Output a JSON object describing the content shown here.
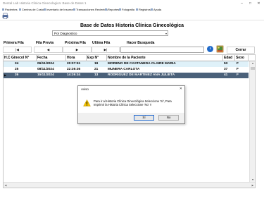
{
  "window": {
    "title": "Dental Lab Historia Clinica Ginecologica: Base de Datos 1",
    "controls": {
      "minimize": "–",
      "maximize": "□",
      "close": "✕"
    }
  },
  "menu": {
    "items": [
      {
        "label": "Pacientes"
      },
      {
        "label": "Centros de Costos"
      },
      {
        "label": "Inventario de Insumos"
      },
      {
        "label": "Transacciones Recientes"
      },
      {
        "label": "Reportes"
      },
      {
        "label": "Fotografia"
      },
      {
        "label": "Registros"
      },
      {
        "label": "Ayuda"
      }
    ]
  },
  "form": {
    "title": "Base de Datos Historia Clínica Ginecológica",
    "search_mode": "Por Diagnostico",
    "labels": {
      "first": "Primera Fila",
      "prev": "Fila Previa",
      "next": "Próxima Fila",
      "last": "Ultima Fila",
      "search": "Hacer Busqueda"
    },
    "nav_buttons": {
      "first": "|◀",
      "prev": "◀",
      "next": "▶",
      "last": "▶|"
    },
    "search_value": "",
    "info_icon": "i",
    "close_label": "Cerrar"
  },
  "grid": {
    "columns": [
      "H.C Ginecol N°",
      "Fecha",
      "Hora",
      "Exp N°",
      "Nombre de la Paciente",
      "Edad",
      "Sexo"
    ],
    "rows": [
      {
        "hc": "24",
        "fecha": "06/11/2024",
        "hora": "20:07:51",
        "exp": "19",
        "nombre": "MORENO DE CASTANEDA CLAIRE MARIA",
        "edad": "53",
        "sexo": "F"
      },
      {
        "hc": "25",
        "fecha": "08/11/2024",
        "hora": "22:36:36",
        "exp": "21",
        "nombre": "MUNERA CARLOTA",
        "edad": "37",
        "sexo": "F"
      },
      {
        "hc": "26",
        "fecha": "15/11/2024",
        "hora": "14:26:34",
        "exp": "13",
        "nombre": "RODRIGUEZ DE MARTINEZ ANA JULIETA",
        "edad": "41",
        "sexo": "F"
      }
    ],
    "current_row_marker": "▶",
    "selected_row": 2
  },
  "dialog": {
    "title": "Aviso",
    "close": "✕",
    "icon": "warning-icon",
    "message": "Para ir al Historia Clínica Ginecológica Seleccione 'Si', Para Imprimir la Historia Clínica Seleccione 'No' !!",
    "yes_label": "Sí",
    "no_label": "No"
  },
  "colors": {
    "selected_row_bg": "#4a6079",
    "alt_row_bg": "#dff1f9",
    "accent": "#2a6fd0",
    "warning": "#f2c200"
  }
}
